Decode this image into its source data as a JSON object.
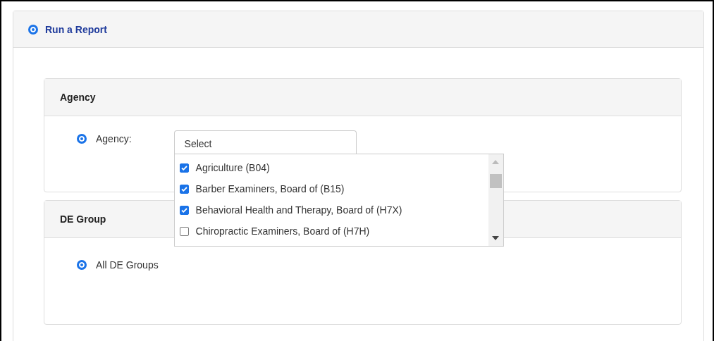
{
  "header": {
    "title": "Run a Report",
    "selected": true
  },
  "agency_panel": {
    "title": "Agency",
    "option": {
      "label": "Agency:",
      "selected": true
    },
    "select": {
      "placeholder": "Select"
    },
    "dropdown": {
      "items": [
        {
          "label": "Agriculture (B04)",
          "checked": true
        },
        {
          "label": "Barber Examiners, Board of (B15)",
          "checked": true
        },
        {
          "label": "Behavioral Health and Therapy, Board of (H7X)",
          "checked": true
        },
        {
          "label": "Chiropractic Examiners, Board of (H7H)",
          "checked": false
        }
      ]
    }
  },
  "de_group_panel": {
    "title": "DE Group",
    "option": {
      "label": "All DE Groups",
      "selected": true
    }
  }
}
